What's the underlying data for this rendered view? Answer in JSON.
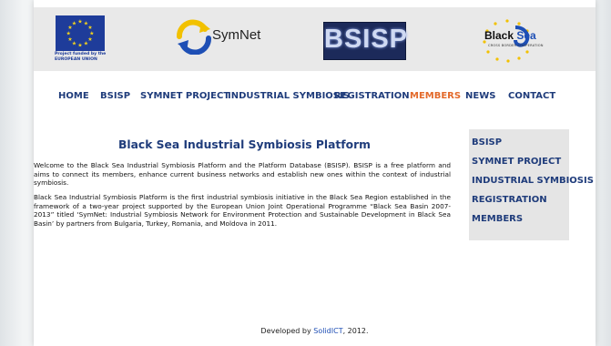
{
  "header": {
    "eu_caption_line1": "Project funded by the",
    "eu_caption_line2": "EUROPEAN UNION",
    "symnet_logo_text": "SymNet",
    "bsisp_logo_text": "BSISP",
    "blacksea_logo_text_a": "Black ",
    "blacksea_logo_text_b": "Sea",
    "blacksea_logo_sub": "CROSS BORDER COOPERATION"
  },
  "nav": {
    "items": [
      {
        "label": "HOME"
      },
      {
        "label": "BSISP"
      },
      {
        "label": "SYMNET PROJECT"
      },
      {
        "label": "INDUSTRIAL SYMBIOSIS"
      },
      {
        "label": "REGISTRATION"
      },
      {
        "label": "MEMBERS",
        "active": true
      },
      {
        "label": "NEWS"
      },
      {
        "label": "CONTACT"
      }
    ],
    "active_color": "#e36a2b",
    "link_color": "#1f3c7b"
  },
  "main": {
    "title": "Black Sea Industrial Symbiosis Platform",
    "paragraph1": "Welcome to the Black Sea Industrial Symbiosis Platform and the Platform Database (BSISP). BSISP is a free platform and aims to connect its members, enhance current business networks and establish new ones within the context of industrial symbiosis.",
    "paragraph2": "Black Sea Industrial Symbiosis Platform is the first industrial symbiosis initiative in the Black Sea Region established in the framework of a two-year project supported by the European Union Joint Operational Programme “Black Sea Basin 2007-2013” titled ‘SymNet: Industrial Symbiosis Network for Environment Protection and Sustainable Development in Black Sea Basin’ by partners from Bulgaria, Turkey, Romania, and Moldova in 2011."
  },
  "sidebar": {
    "items": [
      {
        "label": "BSISP"
      },
      {
        "label": "SYMNET PROJECT"
      },
      {
        "label": "INDUSTRIAL SYMBIOSIS"
      },
      {
        "label": "REGISTRATION"
      },
      {
        "label": "MEMBERS"
      }
    ]
  },
  "footer": {
    "prefix": "Developed by ",
    "link": "SolidICT",
    "suffix": ", 2012."
  }
}
